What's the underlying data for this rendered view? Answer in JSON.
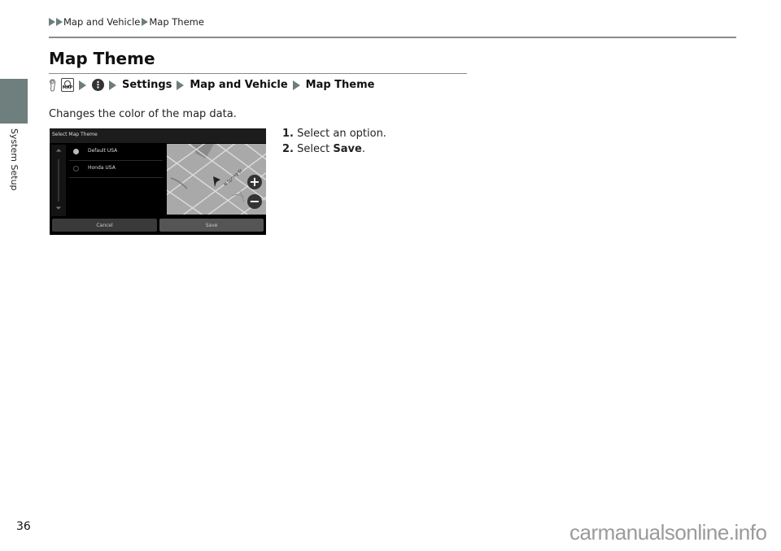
{
  "breadcrumb": {
    "items": [
      "Map and Vehicle",
      "Map Theme"
    ]
  },
  "side_tab": {
    "label": "System Setup",
    "color": "#6f7f7e"
  },
  "title": "Map Theme",
  "path": {
    "icons": [
      "voice-command-icon",
      "map-button-icon",
      "menu-icon"
    ],
    "map_icon_text": "MAP",
    "menu_icon_text": "⋮",
    "steps": [
      "Settings",
      "Map and Vehicle",
      "Map Theme"
    ]
  },
  "description": "Changes the color of the map data.",
  "instructions": [
    {
      "num": "1.",
      "text": "Select an option.",
      "bold": ""
    },
    {
      "num": "2.",
      "text": "Select ",
      "bold": "Save",
      "suffix": "."
    }
  ],
  "screen": {
    "title": "Select Map Theme",
    "options": [
      {
        "label": "Default USA",
        "selected": true
      },
      {
        "label": "Honda USA",
        "selected": false
      }
    ],
    "map_street_label": "N Spring St",
    "zoom_in": "+",
    "zoom_out": "−",
    "scroll_up": "⏶",
    "scroll_down": "⏷",
    "cancel_label": "Cancel",
    "save_label": "Save"
  },
  "page_number": "36",
  "watermark": "carmanualsonline.info"
}
